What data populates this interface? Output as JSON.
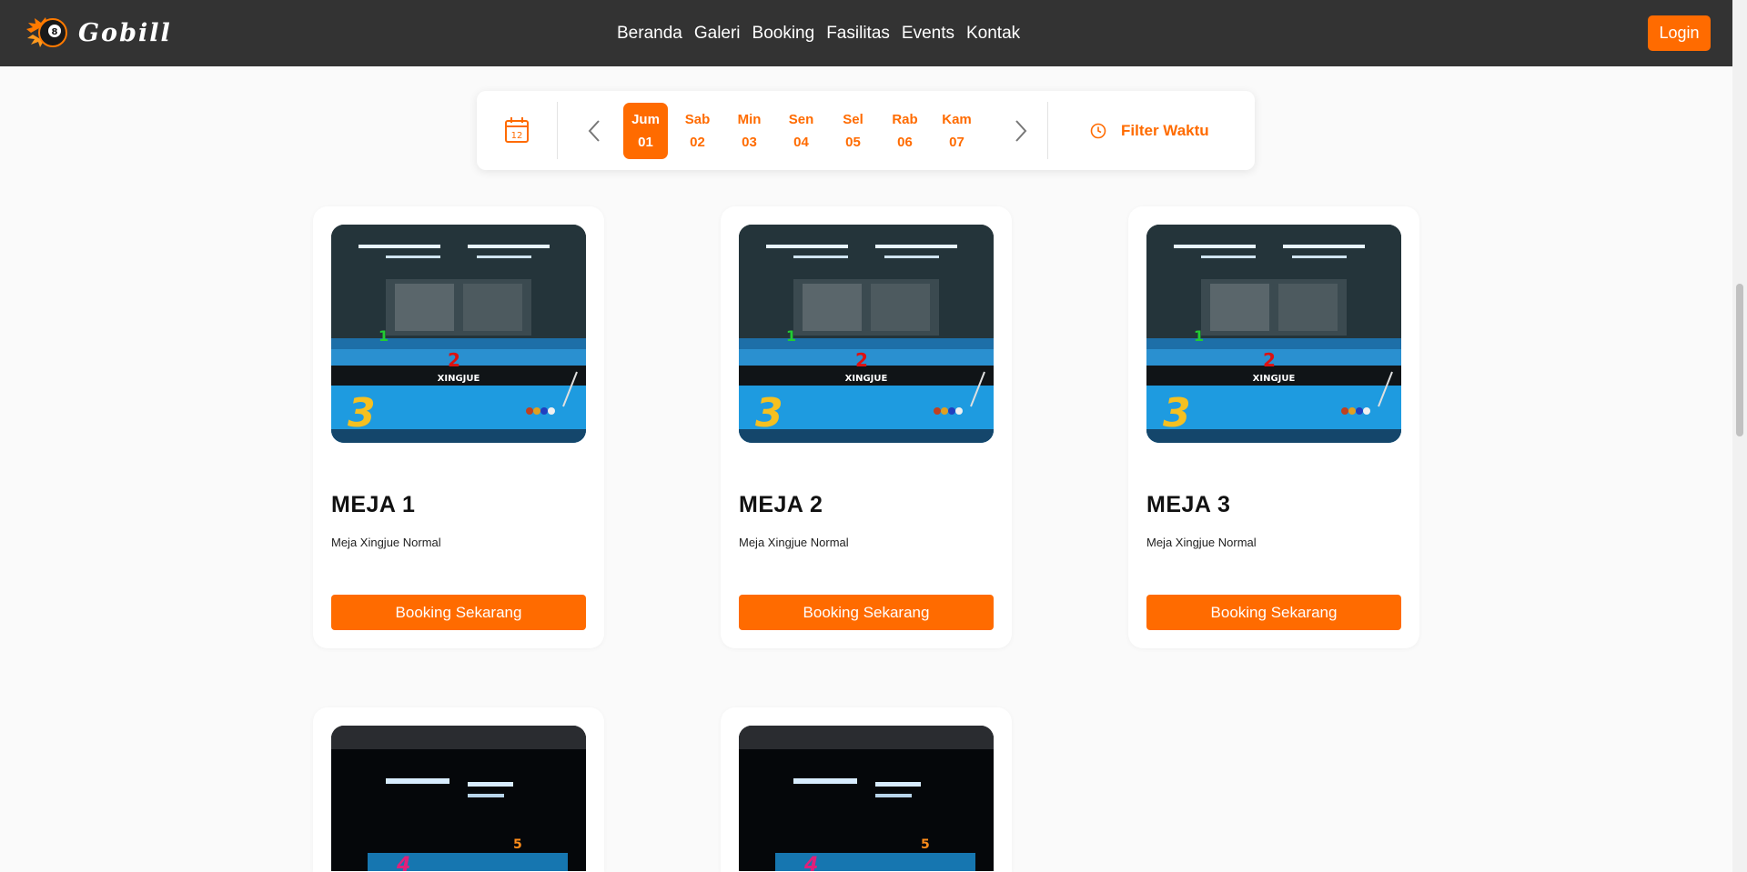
{
  "brand": {
    "name": "Gobill",
    "logo_icon": "eight-ball-flame-icon",
    "accent_color": "#ff6b00",
    "nav_bg": "#333333"
  },
  "nav": {
    "links": [
      "Beranda",
      "Galeri",
      "Booking",
      "Fasilitas",
      "Events",
      "Kontak"
    ],
    "login_label": "Login"
  },
  "date_filter": {
    "calendar_icon": "calendar-icon",
    "calendar_day": "12",
    "days": [
      {
        "name": "Jum",
        "date": "01",
        "selected": true
      },
      {
        "name": "Sab",
        "date": "02",
        "selected": false
      },
      {
        "name": "Min",
        "date": "03",
        "selected": false
      },
      {
        "name": "Sen",
        "date": "04",
        "selected": false
      },
      {
        "name": "Sel",
        "date": "05",
        "selected": false
      },
      {
        "name": "Rab",
        "date": "06",
        "selected": false
      },
      {
        "name": "Kam",
        "date": "07",
        "selected": false
      }
    ],
    "prev_icon": "chevron-left-icon",
    "next_icon": "chevron-right-icon",
    "filter_icon": "clock-icon",
    "filter_label": "Filter Waktu"
  },
  "tables": [
    {
      "name": "MEJA 1",
      "description": "Meja Xingjue Normal",
      "button_label": "Booking Sekarang"
    },
    {
      "name": "MEJA 2",
      "description": "Meja Xingjue Normal",
      "button_label": "Booking Sekarang"
    },
    {
      "name": "MEJA 3",
      "description": "Meja Xingjue Normal",
      "button_label": "Booking Sekarang"
    },
    {
      "name": "",
      "description": "",
      "button_label": ""
    },
    {
      "name": "",
      "description": "",
      "button_label": ""
    }
  ]
}
